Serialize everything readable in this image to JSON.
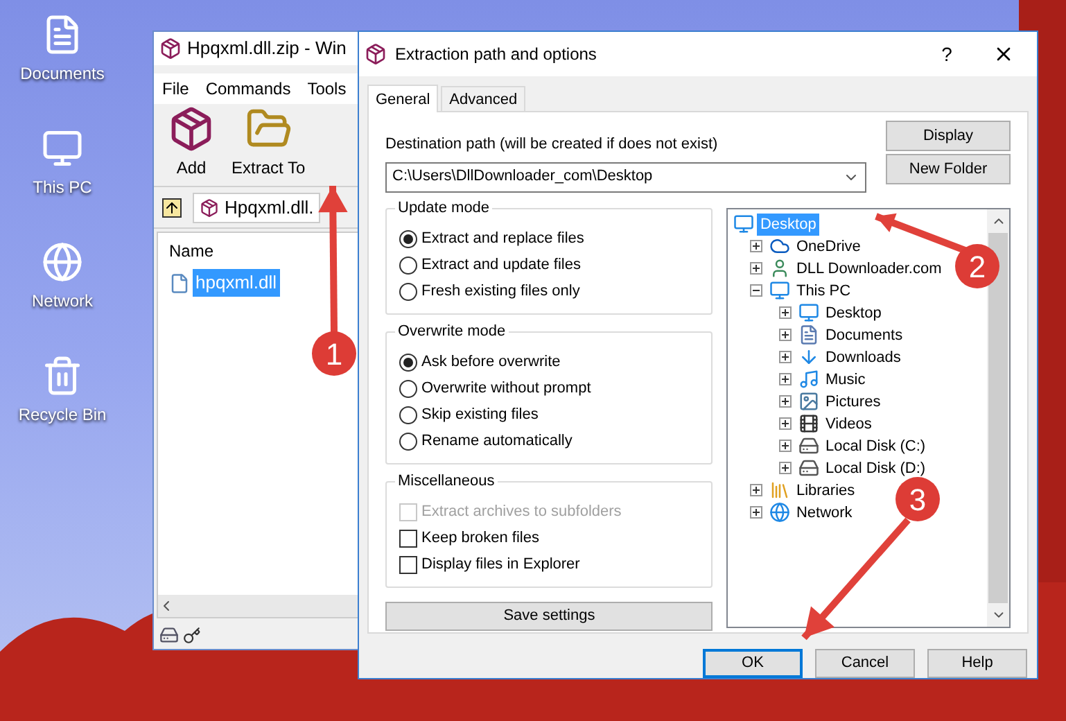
{
  "desktop_icons": [
    {
      "label": "Documents",
      "kind": "documents"
    },
    {
      "label": "This PC",
      "kind": "pc"
    },
    {
      "label": "Network",
      "kind": "network"
    },
    {
      "label": "Recycle Bin",
      "kind": "recycle"
    }
  ],
  "archive_window": {
    "title": "Hpqxml.dll.zip - Win",
    "menu": [
      "File",
      "Commands",
      "Tools"
    ],
    "toolbar": [
      {
        "label": "Add",
        "kind": "add"
      },
      {
        "label": "Extract To",
        "kind": "extract"
      }
    ],
    "path": "Hpqxml.dll.",
    "columns": [
      "Name"
    ],
    "files": [
      {
        "name": "hpqxml.dll",
        "selected": true
      }
    ]
  },
  "dialog": {
    "title": "Extraction path and options",
    "help": "?",
    "tabs": [
      {
        "label": "General",
        "selected": true
      },
      {
        "label": "Advanced",
        "selected": false
      }
    ],
    "destination_label": "Destination path (will be created if does not exist)",
    "destination_path": "C:\\Users\\DllDownloader_com\\Desktop",
    "side_buttons": [
      "Display",
      "New Folder"
    ],
    "update_mode": {
      "title": "Update mode",
      "options": [
        {
          "label": "Extract and replace files",
          "selected": true
        },
        {
          "label": "Extract and update files",
          "selected": false
        },
        {
          "label": "Fresh existing files only",
          "selected": false
        }
      ]
    },
    "overwrite_mode": {
      "title": "Overwrite mode",
      "options": [
        {
          "label": "Ask before overwrite",
          "selected": true
        },
        {
          "label": "Overwrite without prompt",
          "selected": false
        },
        {
          "label": "Skip existing files",
          "selected": false
        },
        {
          "label": "Rename automatically",
          "selected": false
        }
      ]
    },
    "miscellaneous": {
      "title": "Miscellaneous",
      "options": [
        {
          "label": "Extract archives to subfolders",
          "checked": false,
          "disabled": true
        },
        {
          "label": "Keep broken files",
          "checked": false,
          "disabled": false
        },
        {
          "label": "Display files in Explorer",
          "checked": false,
          "disabled": false
        }
      ]
    },
    "save_button": "Save settings",
    "tree": [
      {
        "label": "Desktop",
        "kind": "desktop",
        "selected": true,
        "children": [
          {
            "label": "OneDrive",
            "kind": "cloud",
            "expanded": false,
            "selected": false
          },
          {
            "label": "DLL Downloader.com",
            "kind": "user",
            "expanded": false,
            "selected": false
          },
          {
            "label": "This PC",
            "kind": "pc",
            "expanded": true,
            "selected": false,
            "children": [
              {
                "label": "Desktop",
                "kind": "desktop",
                "expanded": false,
                "selected": false
              },
              {
                "label": "Documents",
                "kind": "documents",
                "expanded": false,
                "selected": false
              },
              {
                "label": "Downloads",
                "kind": "downloads",
                "expanded": false,
                "selected": false
              },
              {
                "label": "Music",
                "kind": "music",
                "expanded": false,
                "selected": false
              },
              {
                "label": "Pictures",
                "kind": "pictures",
                "expanded": false,
                "selected": false
              },
              {
                "label": "Videos",
                "kind": "videos",
                "expanded": false,
                "selected": false
              },
              {
                "label": "Local Disk (C:)",
                "kind": "disk",
                "expanded": false,
                "selected": false
              },
              {
                "label": "Local Disk (D:)",
                "kind": "disk",
                "expanded": false,
                "selected": false
              }
            ]
          },
          {
            "label": "Libraries",
            "kind": "libraries",
            "expanded": false,
            "selected": false
          },
          {
            "label": "Network",
            "kind": "network",
            "expanded": false,
            "selected": false
          }
        ]
      }
    ],
    "buttons": [
      {
        "label": "OK",
        "selected": true
      },
      {
        "label": "Cancel",
        "selected": false
      },
      {
        "label": "Help",
        "selected": false
      }
    ]
  },
  "callouts": [
    "1",
    "2",
    "3"
  ]
}
